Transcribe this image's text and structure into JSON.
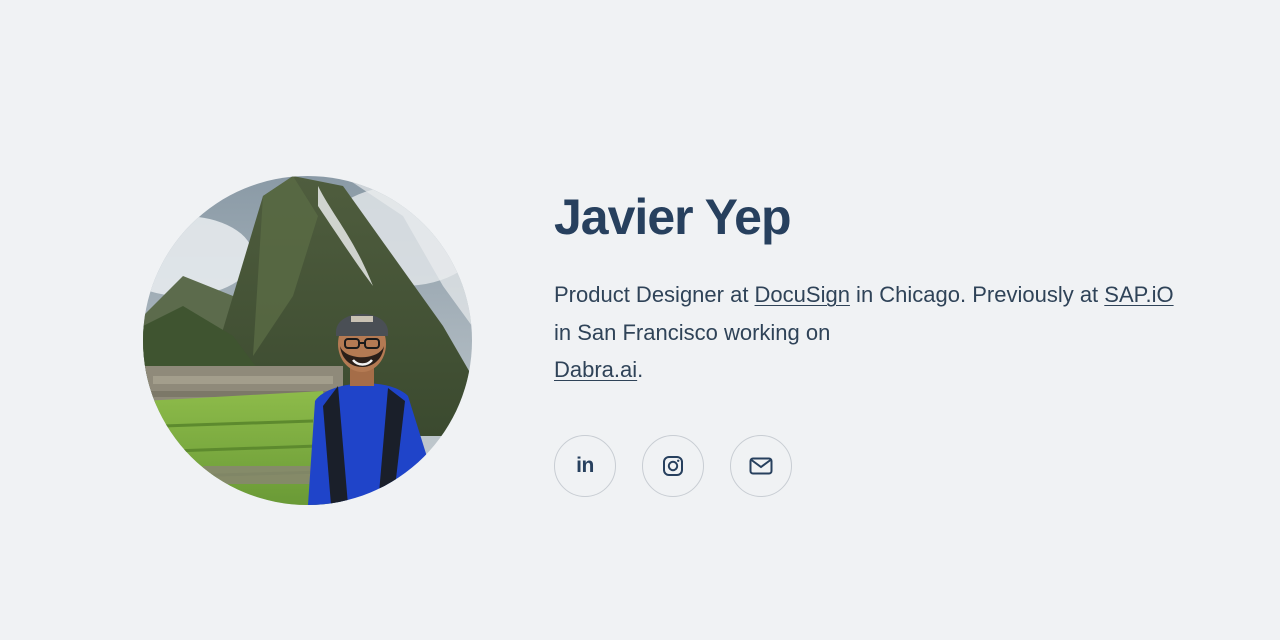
{
  "profile": {
    "name": "Javier Yep",
    "avatar_alt": "Photo of Javier Yep at Machu Picchu"
  },
  "bio": {
    "part1": "Product Designer at ",
    "link1": "DocuSign",
    "part2": " in Chicago. Previously at ",
    "link2": "SAP.iO",
    "part3": " in San Francisco working on ",
    "link3": "Dabra.ai",
    "part4": "."
  },
  "socials": [
    {
      "name": "LinkedIn",
      "icon": "linkedin-icon",
      "glyph": "in"
    },
    {
      "name": "Instagram",
      "icon": "instagram-icon"
    },
    {
      "name": "Email",
      "icon": "mail-icon"
    }
  ],
  "colors": {
    "background": "#f0f2f4",
    "heading": "#27405e",
    "text": "#2f4358",
    "button_border": "#c8cdd3"
  }
}
